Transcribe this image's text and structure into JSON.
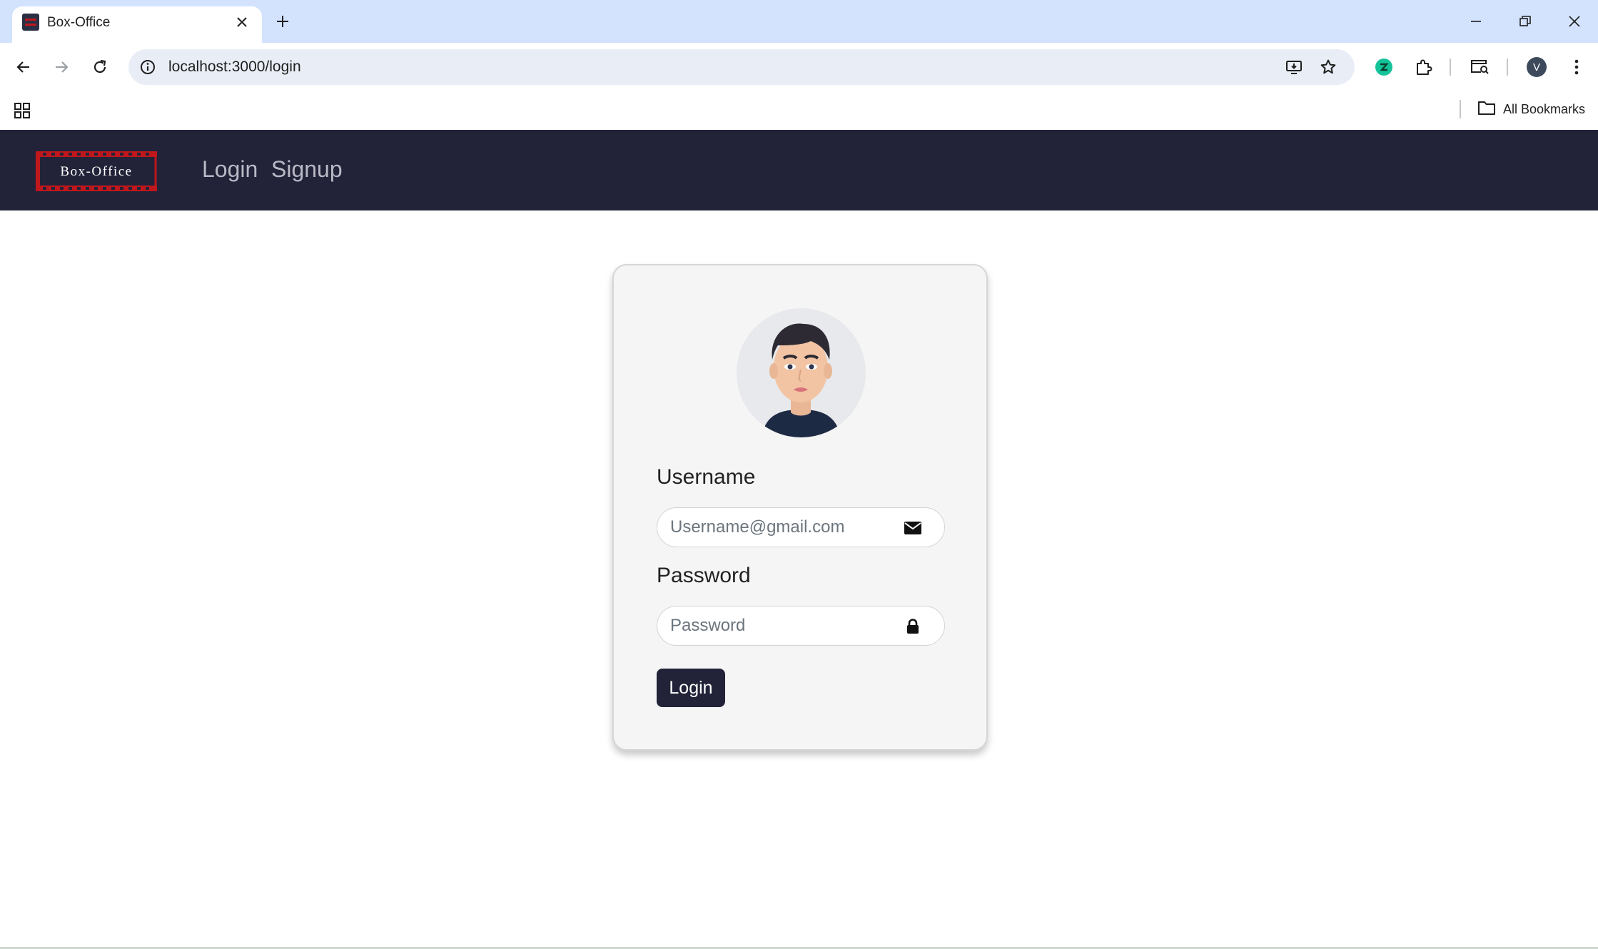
{
  "browser": {
    "tab_title": "Box-Office",
    "url": "localhost:3000/login",
    "profile_initial": "V",
    "bookmarks_label": "All Bookmarks",
    "icons": [
      "back-arrow-icon",
      "forward-arrow-icon",
      "reload-icon",
      "site-info-icon",
      "install-app-icon",
      "star-icon",
      "extension-icon",
      "puzzle-icon",
      "tab-search-icon",
      "kebab-menu-icon"
    ]
  },
  "site": {
    "logo_text": "Box-Office",
    "brand_color": "#222338",
    "accent_color": "#c0171d",
    "nav": [
      {
        "label": "Login"
      },
      {
        "label": "Signup"
      }
    ]
  },
  "login_form": {
    "username_label": "Username",
    "username_placeholder": "Username@gmail.com",
    "password_label": "Password",
    "password_placeholder": "Password",
    "submit_label": "Login"
  }
}
